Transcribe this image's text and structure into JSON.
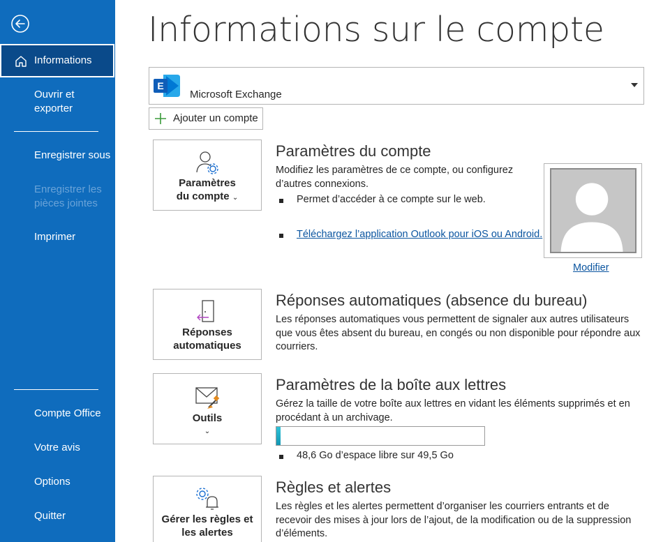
{
  "sidebar": {
    "items": [
      {
        "label": "Informations"
      },
      {
        "label": "Ouvrir et exporter"
      },
      {
        "label": "Enregistrer sous"
      },
      {
        "label": "Enregistrer les pièces jointes"
      },
      {
        "label": "Imprimer"
      },
      {
        "label": "Compte Office"
      },
      {
        "label": "Votre avis"
      },
      {
        "label": "Options"
      },
      {
        "label": "Quitter"
      }
    ],
    "ouvrir_line1": "Ouvrir et",
    "ouvrir_line2": "exporter",
    "pj_line1": "Enregistrer les",
    "pj_line2": "pièces jointes"
  },
  "page": {
    "title": "Informations sur le compte"
  },
  "account": {
    "name": "Microsoft Exchange",
    "add_label": "Ajouter un compte"
  },
  "sections": {
    "account_settings": {
      "tile_line1": "Paramètres",
      "tile_line2": "du compte",
      "title": "Paramètres du compte",
      "desc": "Modifiez les paramètres de ce compte, ou configurez d’autres connexions.",
      "bullet1": "Permet d’accéder à ce compte sur le web.",
      "bullet2": "Téléchargez l’application Outlook pour iOS ou Android.",
      "modify": "Modifier"
    },
    "auto_replies": {
      "tile_line1": "Réponses",
      "tile_line2": "automatiques",
      "title": "Réponses automatiques (absence du bureau)",
      "desc": "Les réponses automatiques vous permettent de signaler aux autres utilisateurs que vous êtes absent du bureau, en congés ou non disponible pour répondre aux courriers."
    },
    "mailbox": {
      "tile_line1": "Outils",
      "title": "Paramètres de la boîte aux lettres",
      "desc": "Gérez la taille de votre boîte aux lettres en vidant les éléments supprimés et en procédant à un archivage.",
      "used_fraction": 0.02,
      "bullet": "48,6 Go d’espace libre sur 49,5 Go"
    },
    "rules": {
      "tile_line1": "Gérer les règles et",
      "tile_line2": "les alertes",
      "title": "Règles et alertes",
      "desc": "Les règles et les alertes permettent d’organiser les courriers entrants et de recevoir des mises à jour lors de l’ajout, de la modification ou de la suppression d’éléments."
    }
  },
  "colors": {
    "sidebar": "#0f6cbd",
    "active_item": "#0a4a8a",
    "link": "#0b55a0",
    "exchange_blue": "#1a6fd1"
  }
}
